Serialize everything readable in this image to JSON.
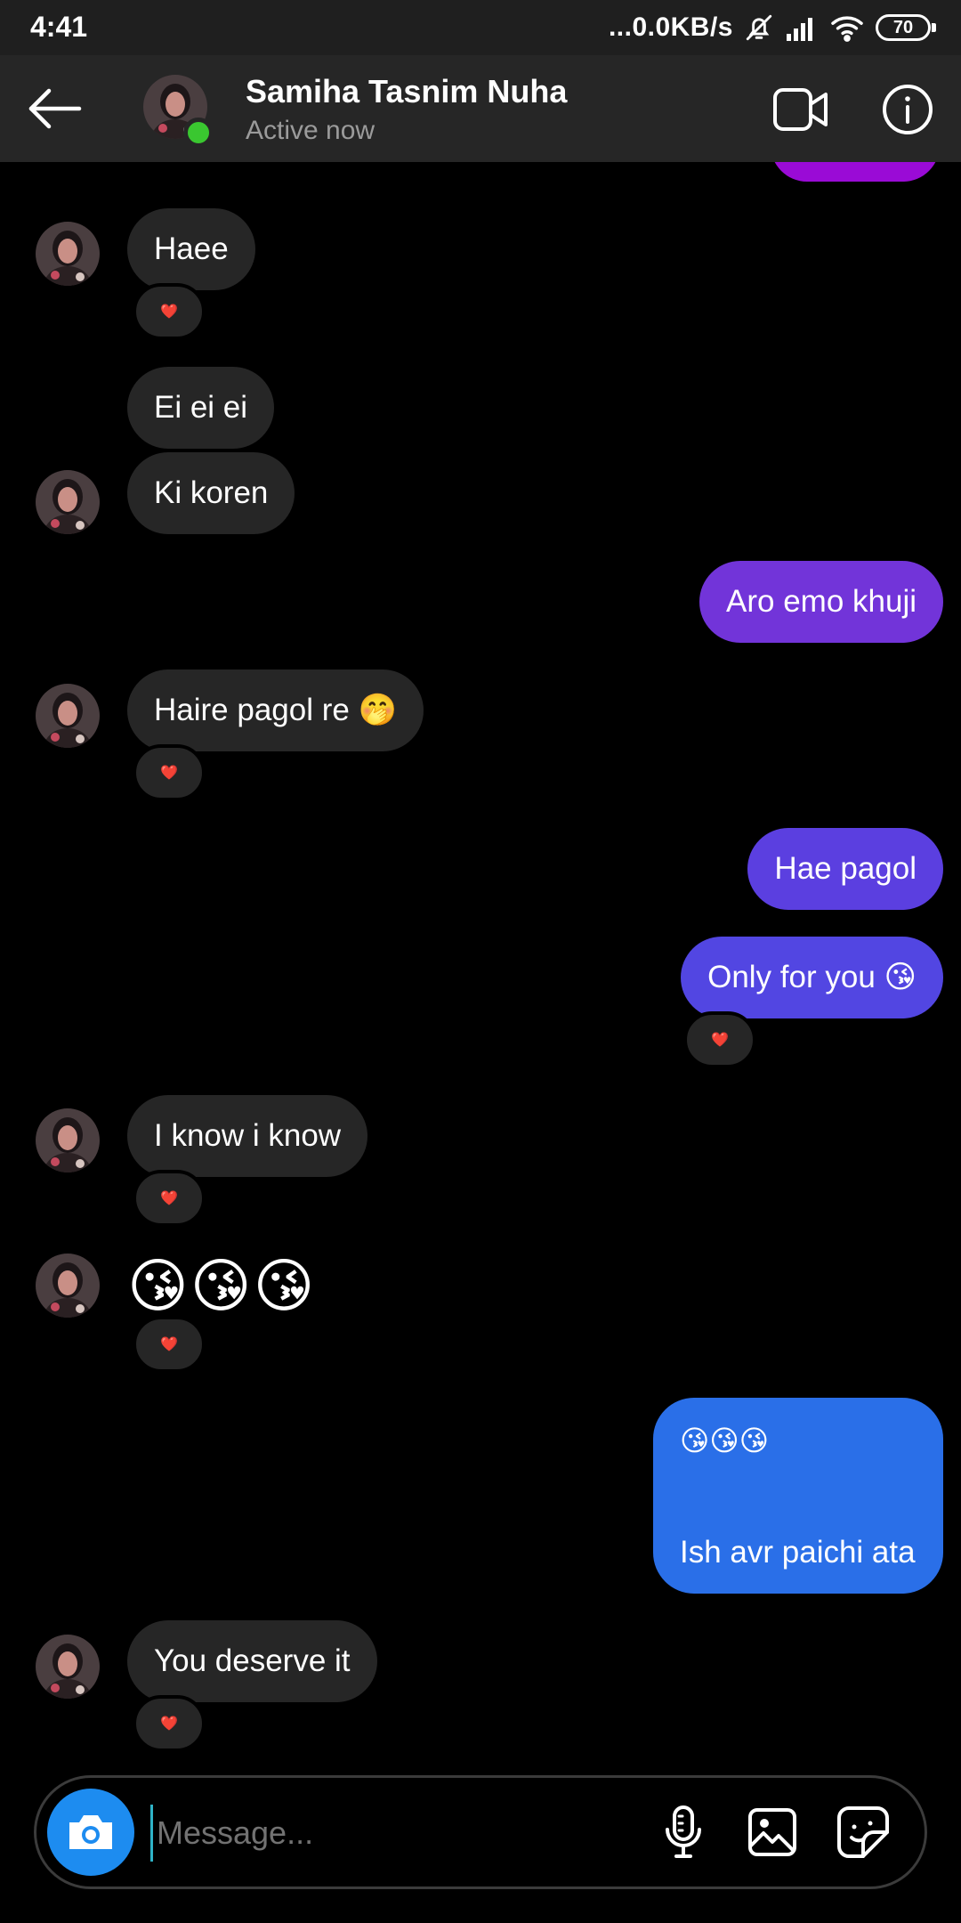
{
  "status_bar": {
    "time": "4:41",
    "network_speed": "...0.0KB/s",
    "battery": "70",
    "icons": [
      "mute-icon",
      "signal-icon",
      "wifi-icon",
      "battery-icon"
    ]
  },
  "header": {
    "contact_name": "Samiha Tasnim Nuha",
    "status": "Active now",
    "icons": [
      "back-arrow-icon",
      "video-call-icon",
      "info-icon"
    ]
  },
  "messages": [
    {
      "from": "them",
      "text": "Haee",
      "reaction": "❤️"
    },
    {
      "from": "them",
      "text": "Ei ei ei"
    },
    {
      "from": "them",
      "text": "Ki koren"
    },
    {
      "from": "me",
      "text": "Aro emo khuji",
      "color": "#7234d9"
    },
    {
      "from": "them",
      "text": "Haire pagol re 🤭",
      "reaction": "❤️"
    },
    {
      "from": "me",
      "text": "Hae pagol",
      "color": "#5b3fe0"
    },
    {
      "from": "me",
      "text": "Only for you 😘",
      "color": "#5246e2",
      "reaction": "❤️"
    },
    {
      "from": "them",
      "text": "I know i know",
      "reaction": "❤️"
    },
    {
      "from": "them",
      "text": "😘😘😘",
      "reaction": "❤️"
    },
    {
      "from": "me",
      "emojis": "😘😘😘",
      "text": "Ish avr paichi ata",
      "color": "#2a6fe8"
    },
    {
      "from": "them",
      "text": "You deserve it",
      "reaction": "❤️"
    }
  ],
  "composer": {
    "placeholder": "Message...",
    "icons": [
      "camera-icon",
      "microphone-icon",
      "gallery-icon",
      "sticker-icon"
    ],
    "camera_color": "#1d8cf0"
  },
  "colors": {
    "background": "#000000",
    "incoming_bubble": "#262626",
    "online": "#3ac730"
  }
}
